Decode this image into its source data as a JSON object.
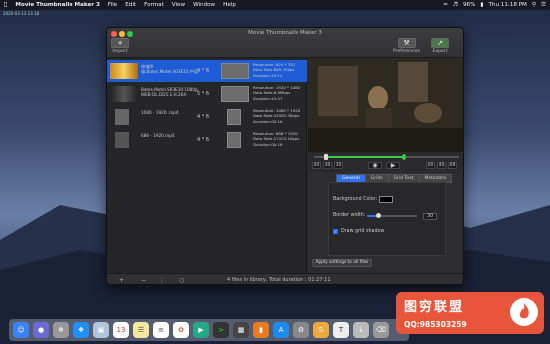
{
  "menubar": {
    "app": "Movie Thumbnails Maker 3",
    "items": [
      "File",
      "Edit",
      "Format",
      "View",
      "Window",
      "Help"
    ],
    "battery": "96%",
    "clock": "Thu 11:18 PM"
  },
  "stamp": "2020-03-13 23:18",
  "window": {
    "title": "Movie Thumbnails Maker 3",
    "import_label": "Import",
    "add_symbol": "+",
    "preferences_label": "Preferences",
    "export_label": "Export"
  },
  "files": [
    {
      "name": "惊魂序\n电.Bates.Motel.S03E10.中英",
      "grid": "4 * 6",
      "info": "Resolution: 624 * 352\nData Rate:669.7Kbps\nDuration:43:12"
    },
    {
      "name": "Bates.Motel.S03E10.1080p.\nWEB-DL.DD5.1.H.264-",
      "grid": "5 * 6",
      "info": "Resolution: 1920 * 1080\nData Rate:6.9Mbps\nDuration:43:57"
    },
    {
      "name": "1080 - 1920 .mp4",
      "grid": "4 * 6",
      "info": "Resolution: 1080 * 1920\nData Rate:24585.3Kbps\nDuration:00:16"
    },
    {
      "name": "686 - 1920.mp4",
      "grid": "4 * 6",
      "info": "Resolution: 686 * 1920\nData Rate:27225.1Kbps\nDuration:00:16"
    }
  ],
  "status": "4 files in library, Total duration : 01:27:11",
  "time": {
    "start": [
      "00",
      "30",
      "30"
    ],
    "end": [
      "00",
      "40",
      "09"
    ]
  },
  "tabs": [
    "General",
    "Grids",
    "Grid Text",
    "Metadata"
  ],
  "general": {
    "bg_color_label": "Background Color:",
    "border_label": "Border width:",
    "border_value": "30",
    "shadow_label": "Draw grid shadow"
  },
  "apply_label": "Apply settings to all files",
  "watermark": {
    "title": "图穷联盟",
    "qq": "QQ:985303259"
  }
}
